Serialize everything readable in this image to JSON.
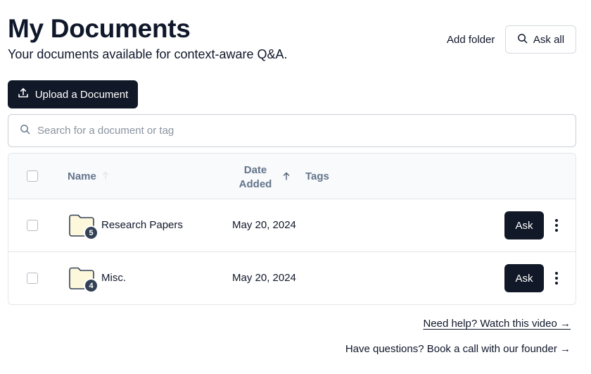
{
  "header": {
    "title": "My Documents",
    "subtitle": "Your documents available for context-aware Q&A."
  },
  "actions": {
    "add_folder": "Add folder",
    "ask_all": "Ask all",
    "upload": "Upload a Document"
  },
  "search": {
    "placeholder": "Search for a document or tag",
    "value": ""
  },
  "table": {
    "columns": {
      "name": "Name",
      "date_line1": "Date",
      "date_line2": "Added",
      "tags": "Tags"
    },
    "rows": [
      {
        "name": "Research Papers",
        "count": "5",
        "date": "May 20, 2024",
        "ask": "Ask"
      },
      {
        "name": "Misc.",
        "count": "4",
        "date": "May 20, 2024",
        "ask": "Ask"
      }
    ]
  },
  "footer": {
    "help": "Need help? Watch this video →",
    "call": "Have questions? Book a call with our founder →"
  },
  "colors": {
    "primary": "#111827",
    "folder_fill": "#fdf8dc",
    "folder_stroke": "#334155",
    "header_bg": "#f8fafc",
    "muted": "#64748b"
  }
}
